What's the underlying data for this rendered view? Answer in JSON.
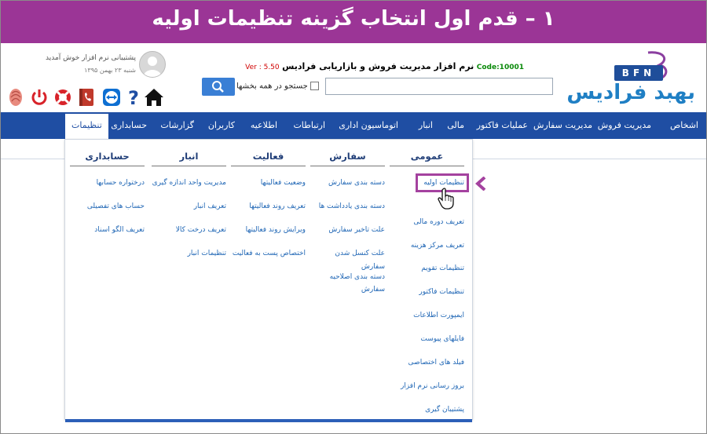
{
  "banner": {
    "title": "۱ – قدم اول انتخاب گزینه تنظیمات اولیه"
  },
  "logo": {
    "badge": "BFN",
    "brand": "بهبد فرادیس"
  },
  "app": {
    "code": "Code:10001",
    "name": "نرم افزار مدیریت فروش و بازاریابی فرادیس",
    "version": "Ver : 5.50"
  },
  "search": {
    "placeholder": "",
    "all_label": "جستجو در همه بخشها"
  },
  "user": {
    "greeting": "پشتیبانی نرم افزار خوش آمدید",
    "date": "شنبه ۲۳ بهمن ۱۳۹۵"
  },
  "toolbar": {
    "icons": [
      "home-icon",
      "help-icon",
      "teamviewer-icon",
      "phonebook-icon",
      "lifebuoy-icon",
      "power-icon",
      "fingerprint-icon"
    ]
  },
  "nav": {
    "items": [
      "اشخاص",
      "مدیریت فروش",
      "مدیریت سفارش",
      "عملیات فاکتور",
      "مالی",
      "انبار",
      "اتوماسیون اداری",
      "ارتباطات",
      "اطلاعیه",
      "کاربران",
      "گزارشات",
      "حسابداری",
      "تنظیمات"
    ],
    "active": "تنظیمات"
  },
  "menu": {
    "columns": [
      {
        "title": "عمومی",
        "items": [
          "تنظیمات اولیه",
          "تعریف دوره مالی",
          "تعریف مرکز هزینه",
          "تنظیمات تقویم",
          "تنظیمات فاکتور",
          "ایمپورت اطلاعات",
          "فایلهای پیوست",
          "فیلد های اختصاصی",
          "بروز رسانی نرم افزار",
          "پشتیبان گیری"
        ]
      },
      {
        "title": "سفارش",
        "items": [
          "دسته بندی سفارش",
          "دسته بندی یادداشت ها",
          "علت تاخیر سفارش",
          "علت کنسل شدن",
          "سفارش",
          "دسته بندی اصلاحیه",
          "سفارش"
        ]
      },
      {
        "title": "فعالیت",
        "items": [
          "وضعیت فعالیتها",
          "تعریف روند فعالیتها",
          "ویرایش روند فعالیتها",
          "اختصاص پست به فعالیت"
        ]
      },
      {
        "title": "انبار",
        "items": [
          "مدیریت واحد اندازه گیری",
          "تعریف انبار",
          "تعریف درخت کالا",
          "تنظیمات انبار"
        ]
      },
      {
        "title": "حسابداری",
        "items": [
          "درختواره حسابها",
          "حساب های تفصیلی",
          "تعریف الگو اسناد"
        ]
      }
    ]
  },
  "colors": {
    "banner": "#9b3596",
    "nav": "#1f4ea3",
    "link": "#1f66b5",
    "highlight": "#a4429f"
  }
}
